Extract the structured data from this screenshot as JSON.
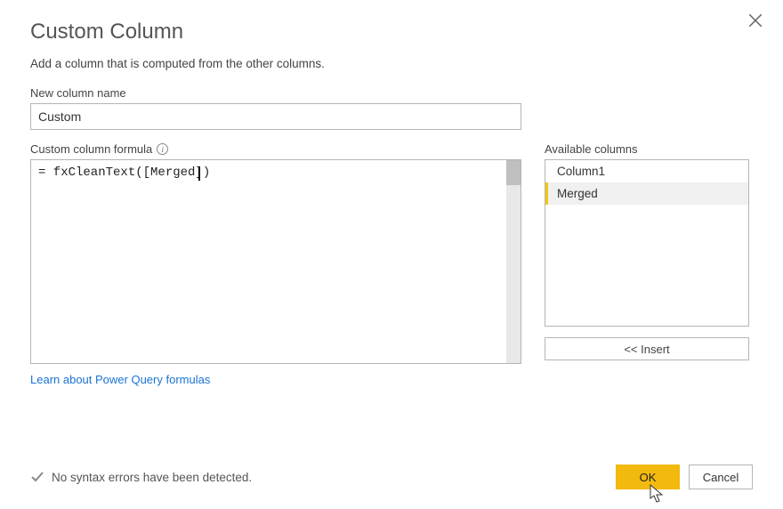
{
  "dialog": {
    "title": "Custom Column",
    "subtitle": "Add a column that is computed from the other columns."
  },
  "name_field": {
    "label": "New column name",
    "value": "Custom"
  },
  "formula_field": {
    "label": "Custom column formula",
    "value": "= fxCleanText([Merged])"
  },
  "available": {
    "label": "Available columns",
    "items": [
      "Column1",
      "Merged"
    ],
    "selected_index": 1
  },
  "insert_button": "<< Insert",
  "learn_link": "Learn about Power Query formulas",
  "status": {
    "message": "No syntax errors have been detected."
  },
  "buttons": {
    "ok": "OK",
    "cancel": "Cancel"
  }
}
